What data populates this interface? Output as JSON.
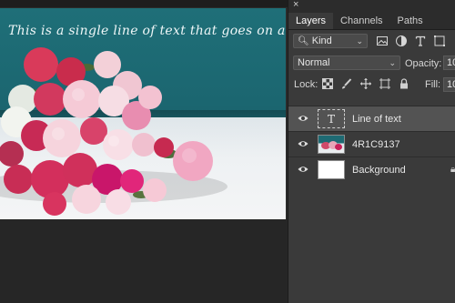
{
  "canvas": {
    "text_line": "This is a single line of text that goes on and on"
  },
  "panel": {
    "close_glyph": "×",
    "tabs": [
      {
        "label": "Layers",
        "active": true
      },
      {
        "label": "Channels",
        "active": false
      },
      {
        "label": "Paths",
        "active": false
      }
    ],
    "filter": {
      "kind_label": "Kind",
      "search_icon": "search-icon",
      "icons": [
        "image-filter-icon",
        "adjustment-filter-icon",
        "type-filter-icon",
        "shape-filter-icon"
      ]
    },
    "blend": {
      "mode": "Normal",
      "opacity_label": "Opacity:",
      "opacity_value": "10"
    },
    "lock": {
      "label": "Lock:",
      "icons": [
        "lock-transparent-icon",
        "lock-paint-icon",
        "lock-position-icon",
        "lock-artboard-icon",
        "lock-all-icon"
      ],
      "fill_label": "Fill:",
      "fill_value": "10"
    },
    "layers": [
      {
        "name": "Line of text",
        "type": "text",
        "thumb_glyph": "T",
        "selected": true
      },
      {
        "name": "4R1C9137",
        "type": "photo",
        "selected": false
      },
      {
        "name": "Background",
        "type": "background",
        "selected": false
      }
    ]
  },
  "colors": {
    "panel_bg": "#3a3a3a",
    "selected_layer": "#535353",
    "canvas_teal": "#1f6f78"
  }
}
